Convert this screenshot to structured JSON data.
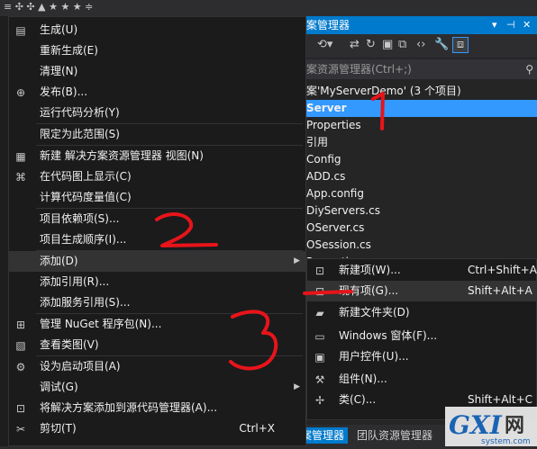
{
  "topbar": {
    "glyphs": "≡ ✣ ✣ ▲ ★ ★ ★ ≑"
  },
  "solution_explorer": {
    "title": "案管理器",
    "search_placeholder": "案资源管理器(Ctrl+;)",
    "tree": [
      {
        "label": "案'MyServerDemo' (3 个项目)",
        "selected": false
      },
      {
        "label": "Server",
        "selected": true
      },
      {
        "label": "Properties",
        "selected": false
      },
      {
        "label": "引用",
        "selected": false
      },
      {
        "label": "Config",
        "selected": false
      },
      {
        "label": "ADD.cs",
        "selected": false
      },
      {
        "label": "App.config",
        "selected": false
      },
      {
        "label": "DiyServers.cs",
        "selected": false
      },
      {
        "label": "OServer.cs",
        "selected": false
      },
      {
        "label": "OSession.cs",
        "selected": false
      },
      {
        "label": "Properties",
        "selected": false
      }
    ],
    "bottom_tabs": [
      {
        "label": "案管理器",
        "active": true
      },
      {
        "label": "团队资源管理器",
        "active": false
      }
    ]
  },
  "context_menu": {
    "items": [
      {
        "label": "生成(U)",
        "icon": "build-icon"
      },
      {
        "label": "重新生成(E)"
      },
      {
        "label": "清理(N)"
      },
      {
        "label": "发布(B)...",
        "icon": "publish-icon"
      },
      {
        "label": "运行代码分析(Y)"
      },
      {
        "label": "限定为此范围(S)"
      },
      {
        "label": "新建 解决方案资源管理器 视图(N)",
        "icon": "new-view-icon"
      },
      {
        "label": "在代码图上显示(C)",
        "icon": "code-map-icon"
      },
      {
        "label": "计算代码度量值(C)"
      },
      {
        "label": "项目依赖项(S)..."
      },
      {
        "label": "项目生成顺序(I)..."
      },
      {
        "label": "添加(D)",
        "submenu": true
      },
      {
        "label": "添加引用(R)..."
      },
      {
        "label": "添加服务引用(S)..."
      },
      {
        "label": "管理 NuGet 程序包(N)...",
        "icon": "nuget-icon"
      },
      {
        "label": "查看类图(V)",
        "icon": "class-diagram-icon"
      },
      {
        "label": "设为启动项目(A)",
        "icon": "gear-icon"
      },
      {
        "label": "调试(G)",
        "submenu": true
      },
      {
        "label": "将解决方案添加到源代码管理器(A)...",
        "icon": "source-control-icon"
      },
      {
        "label": "剪切(T)",
        "shortcut": "Ctrl+X",
        "icon": "cut-icon"
      }
    ]
  },
  "add_submenu": {
    "items": [
      {
        "label": "新建项(W)...",
        "shortcut": "Ctrl+Shift+A"
      },
      {
        "label": "现有项(G)...",
        "shortcut": "Shift+Alt+A"
      },
      {
        "label": "新建文件夹(D)"
      },
      {
        "label": "Windows 窗体(F)..."
      },
      {
        "label": "用户控件(U)..."
      },
      {
        "label": "组件(N)..."
      },
      {
        "label": "类(C)...",
        "shortcut": "Shift+Alt+C"
      }
    ]
  },
  "annotations": [
    "1",
    "2",
    "3"
  ],
  "watermark": {
    "brand": "GXI",
    "suffix": "网",
    "url": "system.com"
  },
  "colors": {
    "accent": "#007acc",
    "selection": "#3399ff",
    "annotation": "#e8141a"
  }
}
